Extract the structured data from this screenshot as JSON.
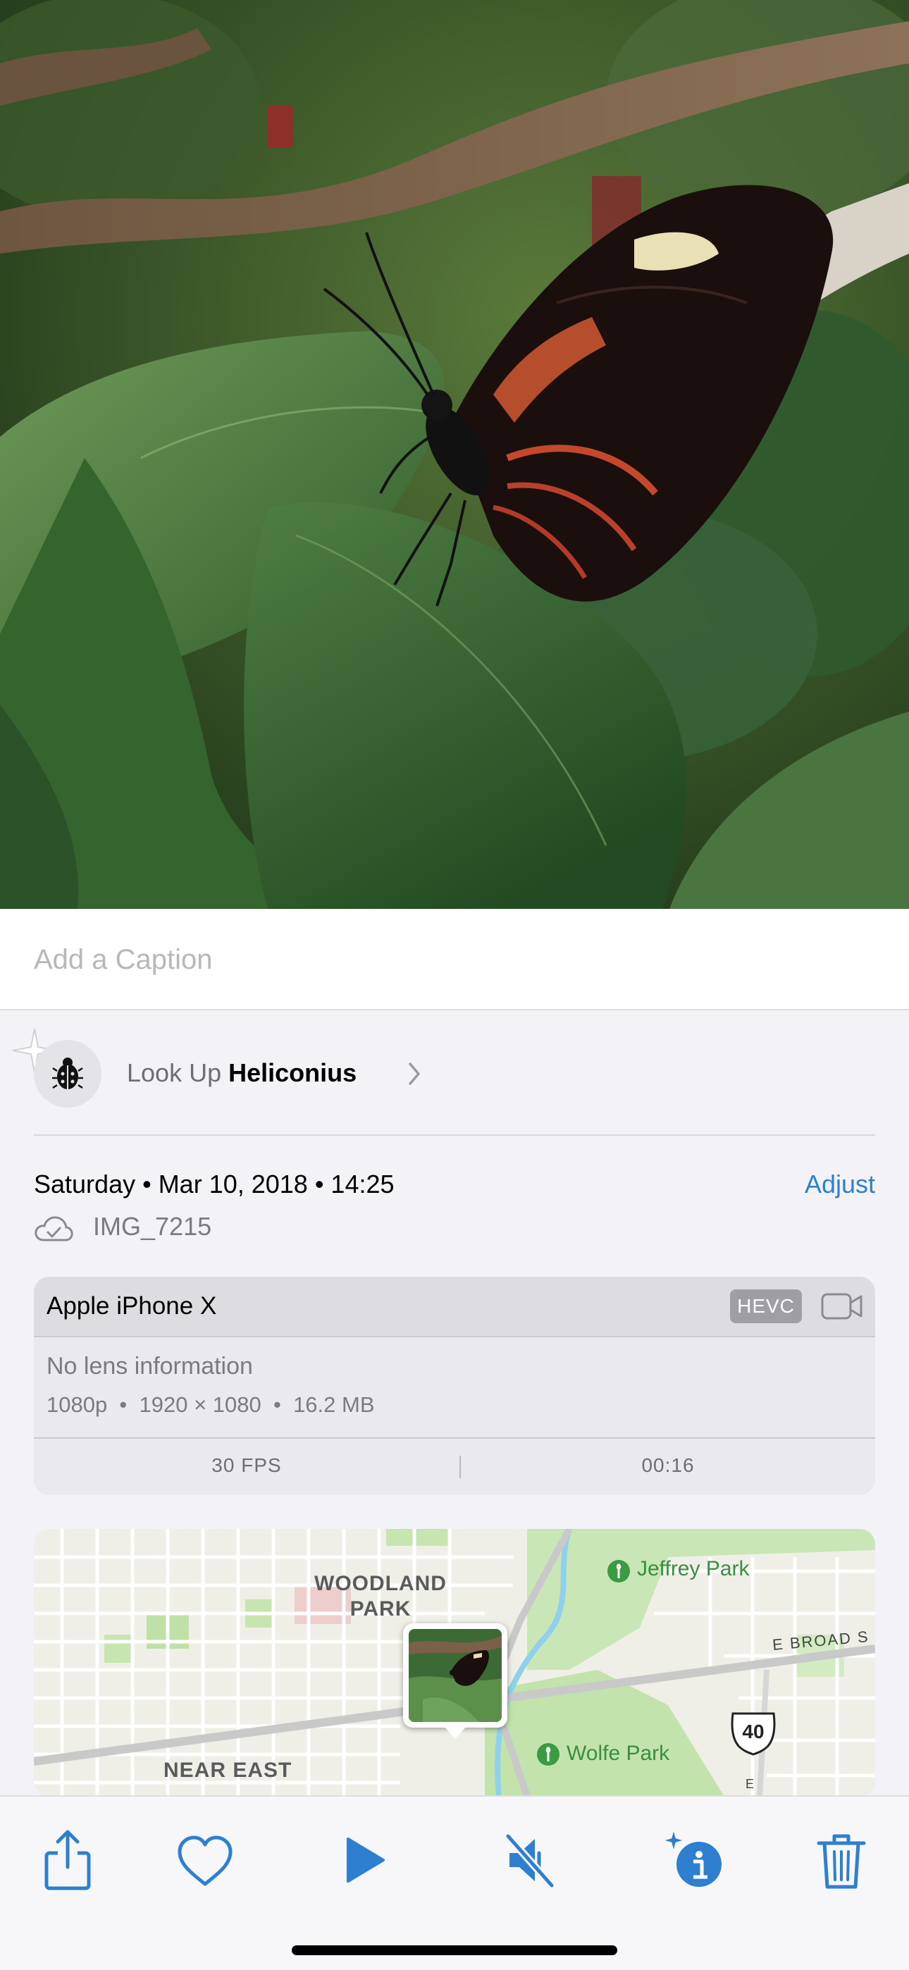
{
  "caption": {
    "placeholder": "Add a Caption",
    "value": ""
  },
  "lookup": {
    "prefix": "Look Up",
    "subject": "Heliconius",
    "icon": "ladybug-icon"
  },
  "metadata": {
    "date_line": "Saturday • Mar 10, 2018 • 14:25",
    "adjust_label": "Adjust",
    "filename": "IMG_7215",
    "cloud_icon": "icloud-icon"
  },
  "device": {
    "name": "Apple iPhone X",
    "format_badge": "HEVC",
    "lens": "No lens information",
    "specs": "1080p  •  1920 × 1080  •  16.2 MB",
    "fps": "30 FPS",
    "duration": "00:16"
  },
  "map": {
    "neighborhood_1_line1": "WOODLAND",
    "neighborhood_1_line2": "PARK",
    "neighborhood_2": "NEAR EAST",
    "park_1": "Jeffrey Park",
    "park_2": "Wolfe Park",
    "road_label": "E BROAD S",
    "route_shield": "40",
    "road_vertical": "E"
  },
  "toolbar": {
    "items": [
      "share-icon",
      "favorite-heart-icon",
      "play-icon",
      "mute-speaker-icon",
      "info-sparkle-icon",
      "trash-icon"
    ],
    "accent_color": "#2f7fd0"
  },
  "colors": {
    "accent": "#2f7fd0",
    "background": "#f2f2f7"
  }
}
